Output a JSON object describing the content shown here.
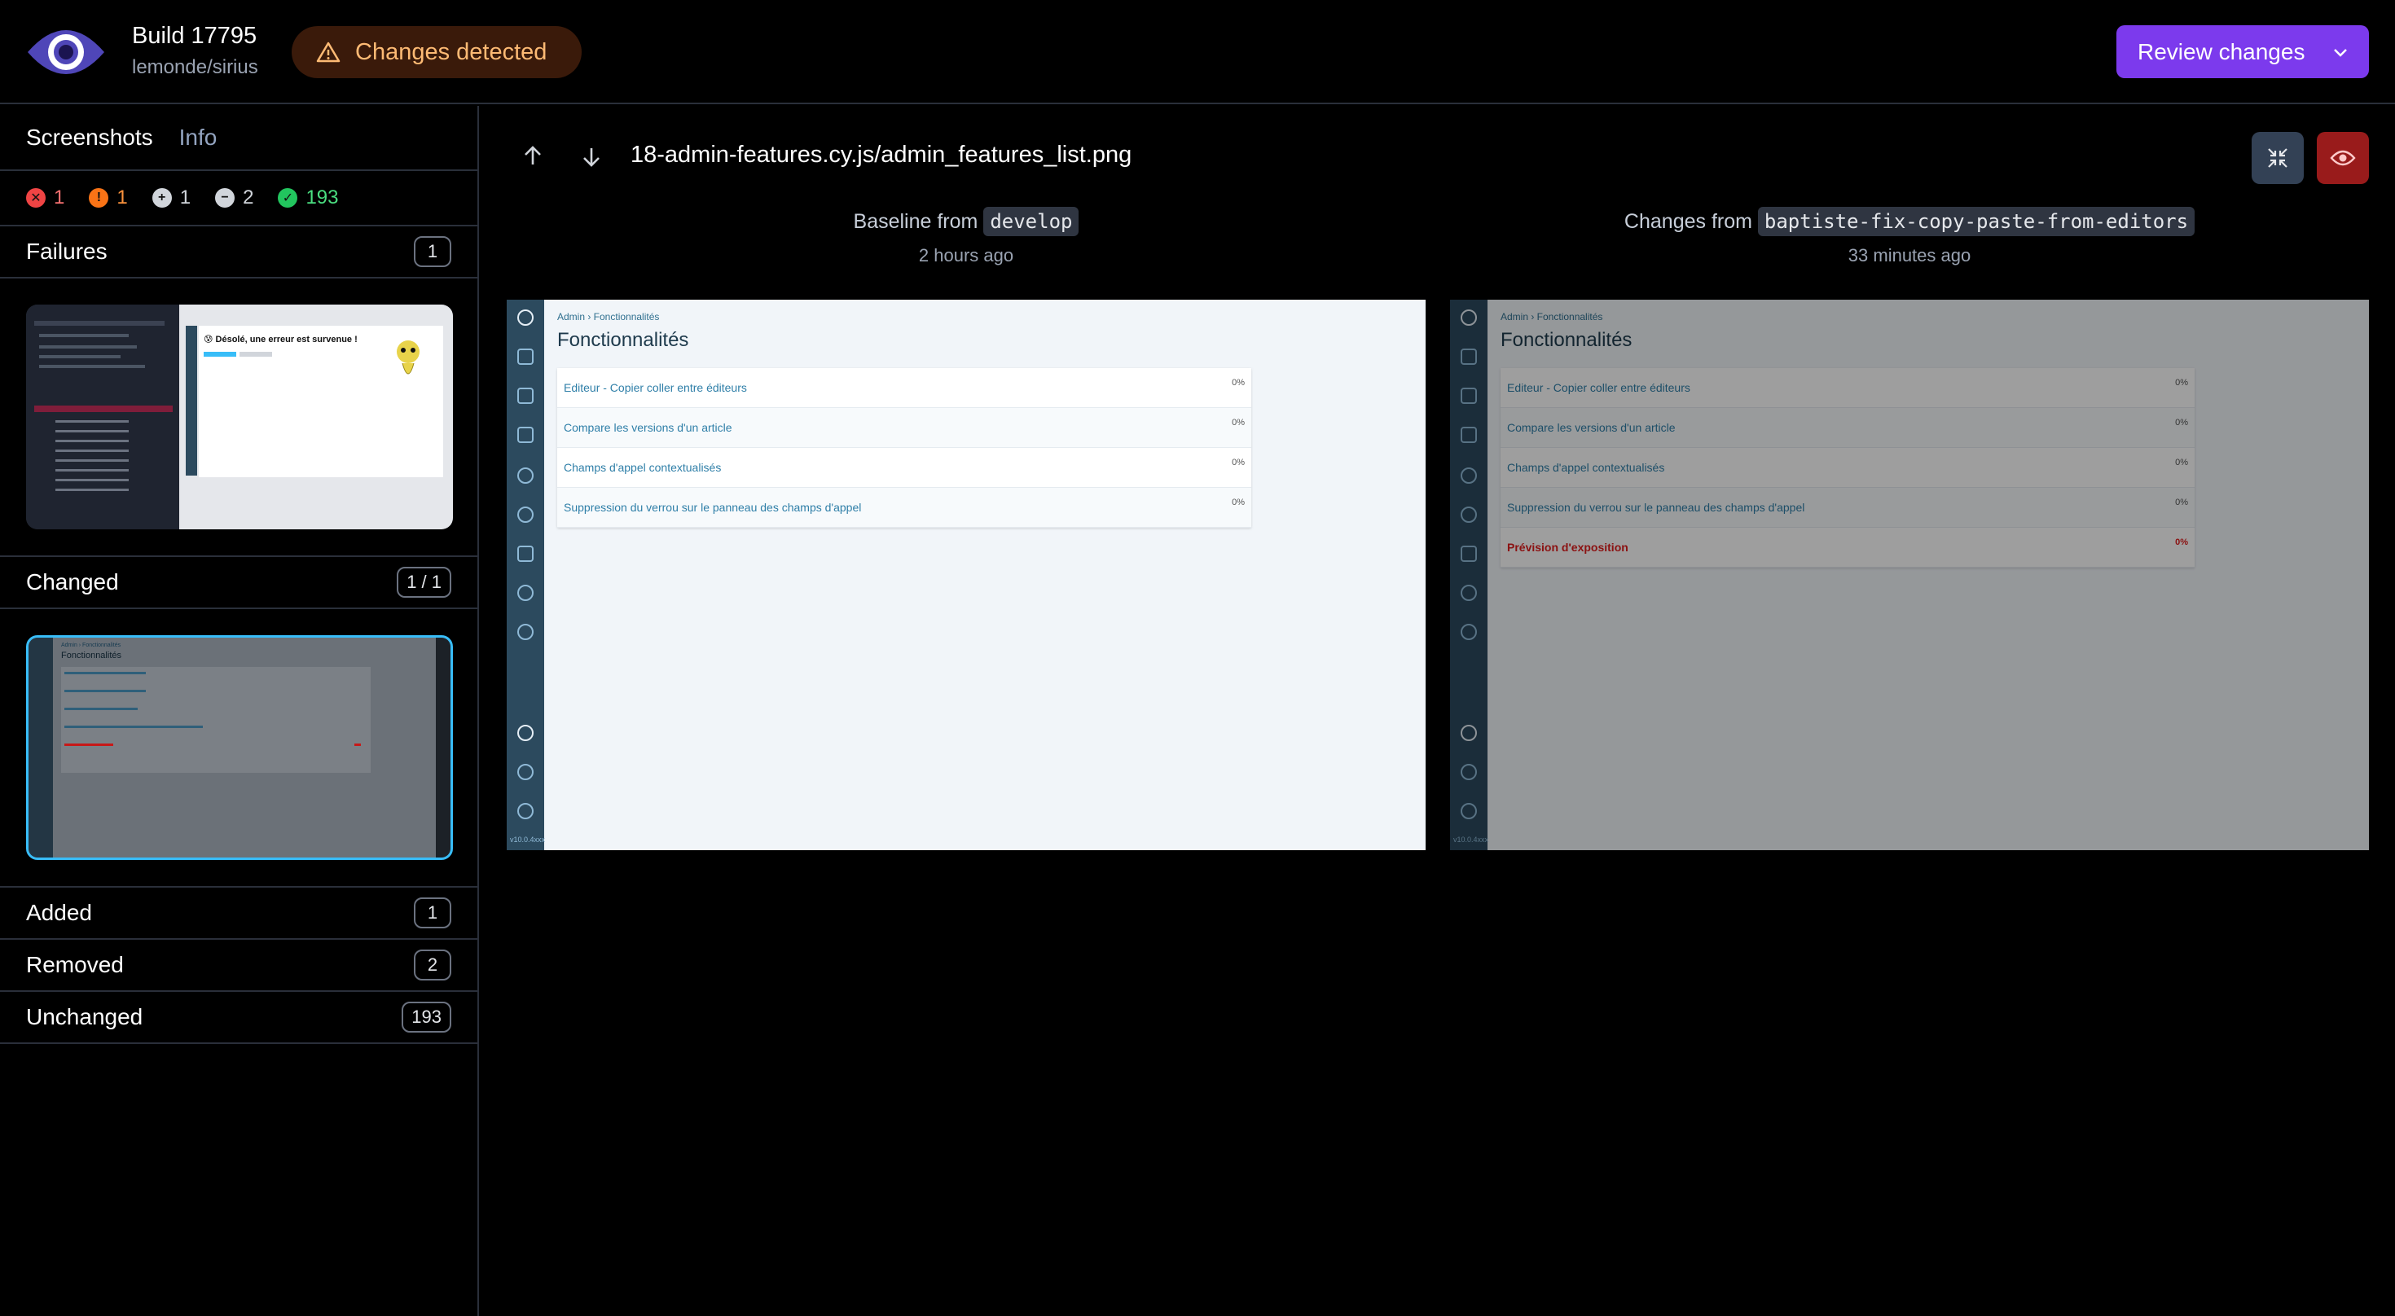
{
  "header": {
    "build_title": "Build 17795",
    "repo": "lemonde/sirius",
    "status_badge": "Changes detected",
    "review_button": "Review changes",
    "colors": {
      "badge_bg": "#3a1a0a",
      "badge_text": "#fdba74",
      "review_bg": "#7c3aed"
    }
  },
  "sidebar": {
    "tabs": [
      {
        "label": "Screenshots",
        "active": true
      },
      {
        "label": "Info",
        "active": false
      }
    ],
    "stats": {
      "failures": "1",
      "changed": "1",
      "added": "1",
      "removed": "2",
      "unchanged": "193"
    },
    "sections": {
      "failures": {
        "label": "Failures",
        "count": "1"
      },
      "changed": {
        "label": "Changed",
        "count": "1 / 1"
      },
      "added": {
        "label": "Added",
        "count": "1"
      },
      "removed": {
        "label": "Removed",
        "count": "2"
      },
      "unchanged": {
        "label": "Unchanged",
        "count": "193"
      }
    },
    "failure_thumb": {
      "error_text": "😰 Désolé, une erreur est survenue !"
    }
  },
  "main": {
    "filename": "18-admin-features.cy.js/admin_features_list.png",
    "baseline": {
      "prefix": "Baseline from",
      "ref": "develop",
      "time": "2 hours ago"
    },
    "changes": {
      "prefix": "Changes from",
      "ref": "baptiste-fix-copy-paste-from-editors",
      "time": "33 minutes ago"
    }
  },
  "screenshot": {
    "breadcrumb": "Admin › Fonctionnalités",
    "title": "Fonctionnalités",
    "version": "v10.0.4xxx",
    "features": [
      {
        "label": "Editeur - Copier coller entre éditeurs",
        "pct": "0%"
      },
      {
        "label": "Compare les versions d'un article",
        "pct": "0%"
      },
      {
        "label": "Champs d'appel contextualisés",
        "pct": "0%"
      },
      {
        "label": "Suppression du verrou sur le panneau des champs d'appel",
        "pct": "0%"
      }
    ],
    "added_feature": {
      "label": "Prévision d'exposition",
      "pct": "0%"
    }
  }
}
